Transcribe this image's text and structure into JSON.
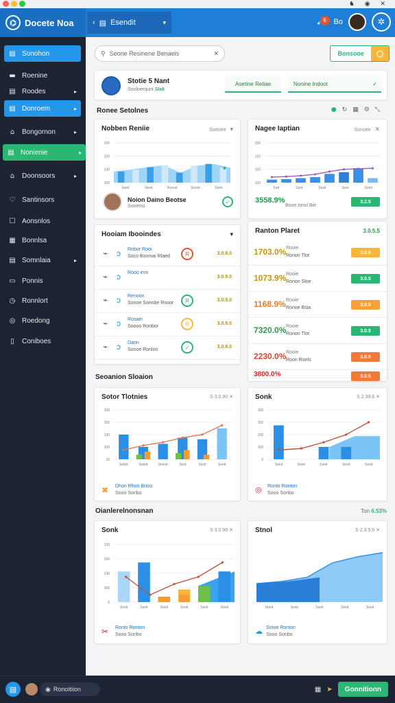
{
  "titlebar": {
    "dots": [
      "#ff5f56",
      "#ffbd2e",
      "#27c93f"
    ],
    "icons": "♞ ◉ ✕"
  },
  "header": {
    "brand": "Docete Noa",
    "workspace": "Esendit",
    "notif_count": "6",
    "right_label": "Bo"
  },
  "sidebar": {
    "items": [
      {
        "label": "Sonohon",
        "icon": "▤",
        "active": true
      },
      {
        "label": "Roenine",
        "icon": "▬",
        "active": false
      },
      {
        "label": "Roodes",
        "icon": "▤",
        "active": false,
        "caret": true
      },
      {
        "label": "Donroem",
        "icon": "▤",
        "active": true,
        "caret": true
      },
      {
        "label": "Bongornon",
        "icon": "⌂",
        "active": false,
        "caret": true
      },
      {
        "label": "Nonienie",
        "icon": "▤",
        "active": false,
        "green": true,
        "caret": true
      },
      {
        "label": "Doonsoors",
        "icon": "⌂",
        "active": false,
        "caret": true
      },
      {
        "label": "Santinsors",
        "icon": "♡",
        "active": false
      },
      {
        "label": "Aonsnlos",
        "icon": "☐",
        "active": false
      },
      {
        "label": "Bonnlsa",
        "icon": "▦",
        "active": false
      },
      {
        "label": "Somnlaia",
        "icon": "▤",
        "active": false,
        "caret": true
      },
      {
        "label": "Ponnis",
        "icon": "▭",
        "active": false
      },
      {
        "label": "Ronnlort",
        "icon": "◷",
        "active": false
      },
      {
        "label": "Roedong",
        "icon": "◎",
        "active": false
      },
      {
        "label": "Coniboes",
        "icon": "▯",
        "active": false
      }
    ]
  },
  "search": {
    "placeholder": "Seone Resinene Benaeis"
  },
  "top_button": {
    "label": "Bonsooe"
  },
  "profile": {
    "name": "Stotie 5 Nant",
    "sub": "Sooloerqunt",
    "sub_tag": "Slak",
    "box1": "Aoetine Retiae",
    "box2": "Nonine Indoot"
  },
  "section_tools": {
    "label": "Ronee Setolnes"
  },
  "panel_a": {
    "title": "Nobben Reniie",
    "right": "Sortoee",
    "yticks": [
      "150",
      "150",
      "130",
      "100"
    ],
    "xticks": [
      "Sonit",
      "Nosit",
      "Roonit",
      "Scsnit",
      "Sonit"
    ],
    "person": "Noion Daino Beotse",
    "person_sub": "Sonensi"
  },
  "panel_b": {
    "title": "Nagee Iaptian",
    "right": "Sonoee",
    "yticks": [
      "150",
      "150",
      "150",
      "100"
    ],
    "xticks": [
      "Soit",
      "Sont",
      "Sosit",
      "Sont",
      "Sonit"
    ],
    "stat": "3558.9%",
    "stat_sub": "Booe Ionsl Bie",
    "badge": "3.2.5"
  },
  "panel_c": {
    "title": "Hooiam Ibooindes",
    "rows": [
      {
        "t1": "Robor Rooi",
        "t2": "Soco Bonmai Rlaed",
        "val": "3.0.9.0",
        "ring": "#e05533",
        "ring_icon": "R"
      },
      {
        "t1": "Rooo enn",
        "t2": "",
        "val": "3.0.9.0",
        "ring": "",
        "ring_icon": ""
      },
      {
        "t1": "Renoon",
        "t2": "Sonoe Sonnbe Rooor",
        "val": "3.0.9.0",
        "ring": "#2bb673",
        "ring_icon": "R"
      },
      {
        "t1": "Rosain",
        "t2": "Soooo Ronbor",
        "val": "3.0.9.0",
        "ring": "#f6b73c",
        "ring_icon": "R"
      },
      {
        "t1": "Daon",
        "t2": "Sonoe Ronlon",
        "val": "3.0.9.0",
        "ring": "#2bb673",
        "ring_icon": "✓"
      }
    ]
  },
  "panel_d": {
    "title": "Ranton Plaret",
    "right": "3.0.5.5",
    "rows": [
      {
        "pct": "1703.0%",
        "t1": "Rooie",
        "t2": "Ronon Tlot",
        "badge": "3.0.5",
        "color": "#f6b73c",
        "pct_color": "#c99700"
      },
      {
        "pct": "1073.9%",
        "t1": "Rooie",
        "t2": "Ronon Sloe",
        "badge": "3.0.5",
        "color": "#2bb673",
        "pct_color": "#c99700"
      },
      {
        "pct": "1168.9%",
        "t1": "Rooie",
        "t2": "Ronoe Bsia",
        "badge": "3.0.5",
        "color": "#f6a03c",
        "pct_color": "#e0802a"
      },
      {
        "pct": "7320.0%",
        "t1": "Rooie",
        "t2": "Ronon Tlot",
        "badge": "3.0.5",
        "color": "#2bb673",
        "pct_color": "#2a9a4a"
      },
      {
        "pct": "2230.0%",
        "t1": "Rooie",
        "t2": "Roon Ronls",
        "badge": "3.0.5",
        "color": "#f07a3a",
        "pct_color": "#e0432a"
      },
      {
        "pct": "3800.0%",
        "t1": "",
        "t2": "",
        "badge": "3.0.5",
        "color": "#f07a3a",
        "pct_color": "#d02a2a"
      }
    ]
  },
  "section2": {
    "label": "Seoanion Sloaion"
  },
  "panel_e": {
    "title": "Sotor Tlotnies",
    "right": "S 3.0.90",
    "yticks": [
      "100",
      "150",
      "130",
      "100",
      "10"
    ],
    "xticks": [
      "Sotoit",
      "Sotoit",
      "Sonoit",
      "Sorit",
      "Socit",
      "Sonit"
    ],
    "foot1": "Dhon Rhon Brtoo",
    "foot2": "Sooo Sonbo"
  },
  "panel_f": {
    "title": "Sonk",
    "right": "S 2.39.6",
    "yticks": [
      "100",
      "150",
      "150",
      "100",
      "0"
    ],
    "xticks": [
      "Sonit",
      "Sonit",
      "Sonit",
      "Sonit",
      "Sonit"
    ],
    "foot1": "Ronto Ronton",
    "foot2": "Sooo Sonbo"
  },
  "section3": {
    "label": "Oianlerelnonsnan",
    "right": "Ton",
    "right_val": "6.53%"
  },
  "panel_g": {
    "title": "Sonk",
    "right": "S 3.0.90",
    "yticks": [
      "150",
      "150",
      "130",
      "100",
      "0"
    ],
    "xticks": [
      "Sonit",
      "Sonit",
      "Sonit",
      "Sonit",
      "Sonit",
      "Sonit"
    ],
    "foot1": "Ronto Ronton",
    "foot2": "Sooo Sonbo"
  },
  "panel_h": {
    "title": "Stnol",
    "right": "S 2.3.5.6",
    "xticks": [
      "Sonit",
      "Sonit",
      "Sonit",
      "Sonit",
      "Sonit"
    ],
    "foot1": "Sotoe Ronton",
    "foot2": "Sooo Sonbo"
  },
  "bottom": {
    "pill": "Ronoitiion",
    "button": "Gonnitionn"
  },
  "chart_data": [
    {
      "type": "bar",
      "title": "Nobben Reniie",
      "categories": [
        "Sonit",
        "Nosit",
        "Roonit",
        "Scsnit",
        "Sonit"
      ],
      "series": [
        {
          "values": [
            45,
            52,
            62,
            70,
            40,
            68,
            75,
            60
          ]
        }
      ],
      "ylim": [
        0,
        160
      ]
    },
    {
      "type": "bar",
      "title": "Nagee Iaptian",
      "categories": [
        "Soit",
        "Sont",
        "Sosit",
        "Sont",
        "Sonit"
      ],
      "series": [
        {
          "values": [
            10,
            14,
            18,
            20,
            40,
            45,
            20,
            15
          ]
        },
        {
          "values": [
            20,
            22,
            25,
            30,
            40,
            48,
            50,
            52
          ]
        }
      ],
      "ylim": [
        0,
        160
      ]
    },
    {
      "type": "bar",
      "title": "Sotor Tlotnies",
      "categories": [
        "Sotoit",
        "Sotoit",
        "Sonoit",
        "Sorit",
        "Socit",
        "Sonit"
      ],
      "series": [
        {
          "values": [
            80,
            40,
            50,
            70,
            65,
            100
          ]
        },
        {
          "values": [
            30,
            45,
            55,
            70,
            80,
            110
          ]
        }
      ],
      "ylim": [
        0,
        160
      ]
    },
    {
      "type": "bar",
      "title": "Sonk",
      "categories": [
        "Sonit",
        "Sonit",
        "Sonit",
        "Sonit",
        "Sonit"
      ],
      "series": [
        {
          "values": [
            110,
            40,
            40,
            85,
            75
          ]
        },
        {
          "values": [
            30,
            35,
            55,
            80,
            120
          ]
        }
      ],
      "ylim": [
        0,
        160
      ]
    },
    {
      "type": "bar",
      "title": "Sonk",
      "categories": [
        "Sonit",
        "Sonit",
        "Sonit",
        "Sonit",
        "Sonit",
        "Sonit"
      ],
      "series": [
        {
          "values": [
            85,
            110,
            15,
            35,
            45,
            85
          ]
        },
        {
          "values": [
            70,
            20,
            50,
            70,
            110
          ]
        }
      ],
      "ylim": [
        0,
        160
      ]
    },
    {
      "type": "area",
      "title": "Stnol",
      "categories": [
        "Sonit",
        "Sonit",
        "Sonit",
        "Sonit",
        "Sonit"
      ],
      "series": [
        {
          "values": [
            45,
            50,
            60,
            95,
            110,
            120
          ]
        }
      ],
      "ylim": [
        0,
        140
      ]
    }
  ]
}
